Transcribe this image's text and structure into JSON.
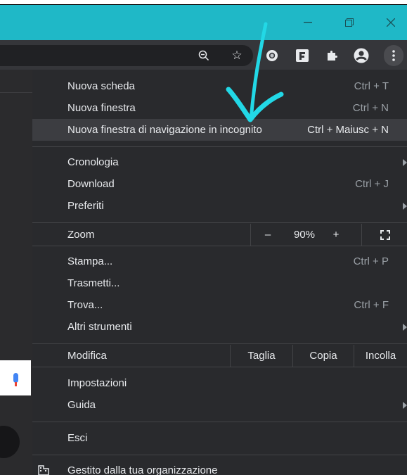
{
  "window": {
    "minimize_icon": "minimize-icon",
    "restore_icon": "restore-icon",
    "close_icon": "close-icon",
    "titlebar_color": "#1fb8c7"
  },
  "toolbar": {
    "icons": [
      "zoom-out-icon",
      "bookmark-star-icon",
      "extension-record-icon",
      "extension-f-icon",
      "extensions-puzzle-icon",
      "profile-icon",
      "more-menu-icon"
    ]
  },
  "menu": {
    "items": [
      {
        "label": "Nuova scheda",
        "shortcut": "Ctrl + T"
      },
      {
        "label": "Nuova finestra",
        "shortcut": "Ctrl + N"
      },
      {
        "label": "Nuova finestra di navigazione in incognito",
        "shortcut": "Ctrl + Maiusc + N"
      },
      {
        "label": "Cronologia",
        "shortcut": ""
      },
      {
        "label": "Download",
        "shortcut": "Ctrl + J"
      },
      {
        "label": "Preferiti",
        "shortcut": ""
      },
      {
        "label": "Stampa...",
        "shortcut": "Ctrl + P"
      },
      {
        "label": "Trasmetti...",
        "shortcut": ""
      },
      {
        "label": "Trova...",
        "shortcut": "Ctrl + F"
      },
      {
        "label": "Altri strumenti",
        "shortcut": ""
      },
      {
        "label": "Impostazioni",
        "shortcut": ""
      },
      {
        "label": "Guida",
        "shortcut": ""
      },
      {
        "label": "Esci",
        "shortcut": ""
      }
    ],
    "zoom": {
      "label": "Zoom",
      "minus": "–",
      "value": "90%",
      "plus": "+"
    },
    "edit": {
      "label": "Modifica",
      "cut": "Taglia",
      "copy": "Copia",
      "paste": "Incolla"
    },
    "managed": "Gestito dalla tua organizzazione"
  }
}
